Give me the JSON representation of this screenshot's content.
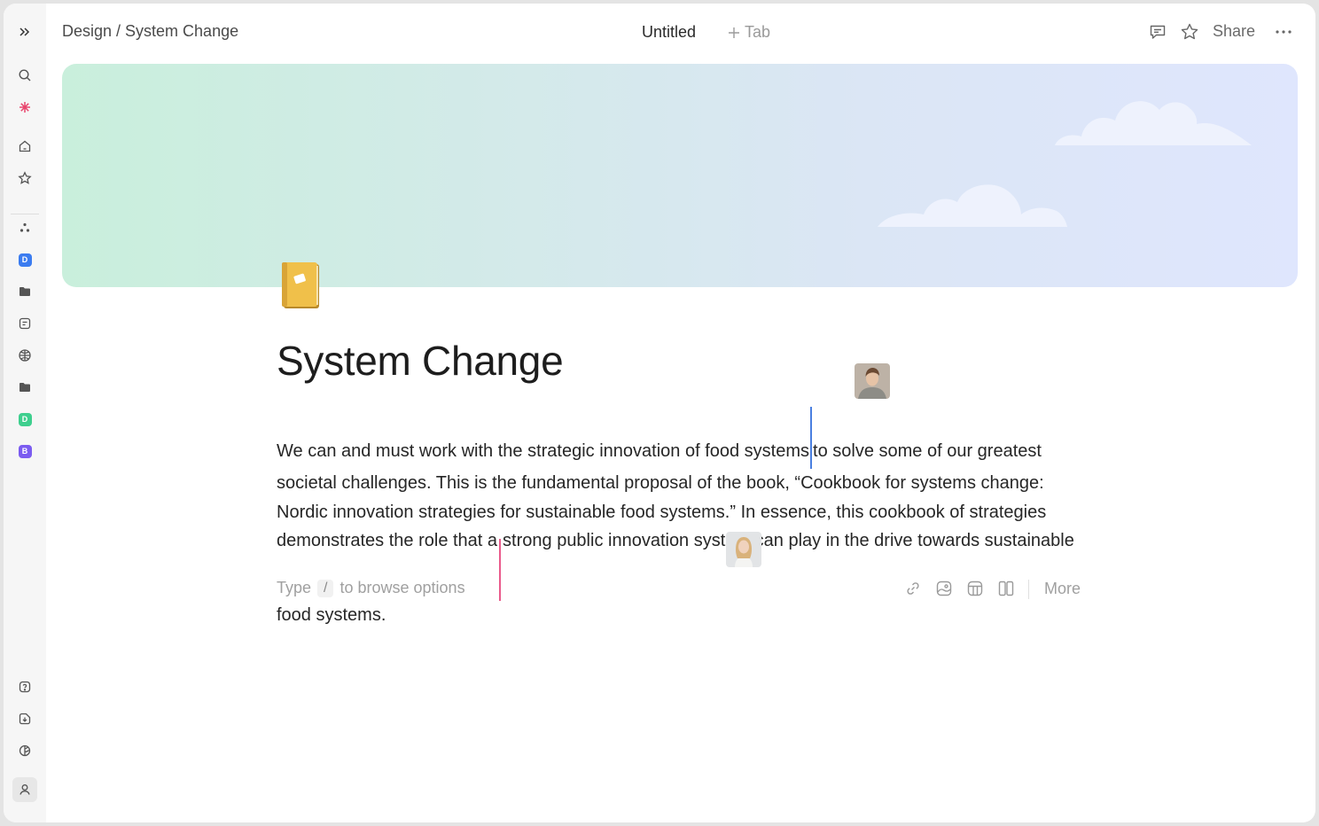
{
  "sidebar": {
    "items": [
      {
        "icon": "expand-icon"
      },
      {
        "icon": "search-icon"
      },
      {
        "icon": "ai-sparkle-icon",
        "color": "#e8466e"
      },
      {
        "icon": "home-icon"
      },
      {
        "icon": "star-icon"
      },
      {
        "icon": "spaces-icon"
      },
      {
        "label": "D",
        "color": "#3b7cf0"
      },
      {
        "icon": "folder-icon"
      },
      {
        "icon": "document-icon"
      },
      {
        "icon": "globe-icon"
      },
      {
        "icon": "folder-icon"
      },
      {
        "label": "D",
        "color": "#3ecf8e"
      },
      {
        "label": "B",
        "color": "#7b5cf0"
      },
      {
        "icon": "help-icon"
      },
      {
        "icon": "import-icon"
      },
      {
        "icon": "trash-icon"
      },
      {
        "icon": "user-icon"
      }
    ]
  },
  "header": {
    "breadcrumb": "Design / System Change",
    "tab_title": "Untitled",
    "add_tab_label": "Tab",
    "share_label": "Share"
  },
  "page": {
    "emoji": "notebook-emoji",
    "title": "System Change",
    "paragraph": {
      "part1": "We can and must work with the strategic innovation of food systems",
      "part2": "to solve some of our greatest societal challenges. This is the fundamental proposal of the book, “Cookbook for systems change: Nordic innovation strategies for sustainable food systems.” In essence, this cookbook of strategies  demonstrates the role that a",
      "part3": "strong public innovation system can play in the drive towards sustainable food systems."
    },
    "collaborator_colors": {
      "first": "#4a7fe0",
      "second": "#ea5b8c"
    }
  },
  "editor_hint": {
    "prefix": "Type",
    "key": "/",
    "suffix": "to browse options",
    "more_label": "More"
  }
}
